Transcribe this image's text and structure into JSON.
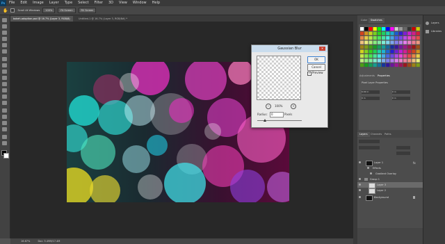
{
  "app": {
    "logo": "Ps"
  },
  "menu": [
    "File",
    "Edit",
    "Image",
    "Layer",
    "Type",
    "Select",
    "Filter",
    "3D",
    "View",
    "Window",
    "Help"
  ],
  "options_bar": {
    "scroll_all_windows": "Scroll All Windows",
    "zoom": "100%",
    "fit_screen": "Fit Screen",
    "fill_screen": "Fill Screen"
  },
  "document_tabs": [
    {
      "label": "bokeh-adoption.psd @ 16.7% (Layer 3, RGB/8) *",
      "active": true
    },
    {
      "label": "Untitled-1 @ 16.7% (Layer 3, RGB/8#) *",
      "active": false
    }
  ],
  "status_bar": {
    "zoom": "16.67%",
    "doc_size": "Doc: 5.49M/17.4M"
  },
  "panels": {
    "top_tabs": [
      "Color",
      "Swatches"
    ],
    "mid_tabs": [
      "Adjustments",
      "Properties"
    ],
    "properties_title": "Pixel Layer Properties",
    "properties_fields": [
      "6.69 in",
      "0 in",
      "0 in",
      "0 in"
    ],
    "layers_tabs": [
      "Layers",
      "Channels",
      "Paths"
    ],
    "layers": [
      {
        "name": "Layer 1",
        "thumb": "#111"
      },
      {
        "name": "Effects",
        "thumb": ""
      },
      {
        "name": "Gradient Overlay",
        "thumb": ""
      },
      {
        "name": "Group 1",
        "thumb": ""
      },
      {
        "name": "Layer 3",
        "thumb": "#ddd"
      },
      {
        "name": "Layer 2",
        "thumb": "#ddd"
      },
      {
        "name": "Background",
        "thumb": "#111"
      }
    ],
    "right_column": [
      "Layers",
      "Libraries"
    ]
  },
  "dialog": {
    "title": "Gaussian Blur",
    "ok": "OK",
    "cancel": "Cancel",
    "preview_label": "Preview",
    "preview_checked": true,
    "zoom": "100%",
    "radius_label": "Radius:",
    "radius_value": "0",
    "radius_unit": "Pixels"
  },
  "colors": {
    "bokeh": [
      "#e832c0",
      "#20d8d0",
      "#f0e020",
      "#9040e0",
      "#ffffff"
    ]
  }
}
